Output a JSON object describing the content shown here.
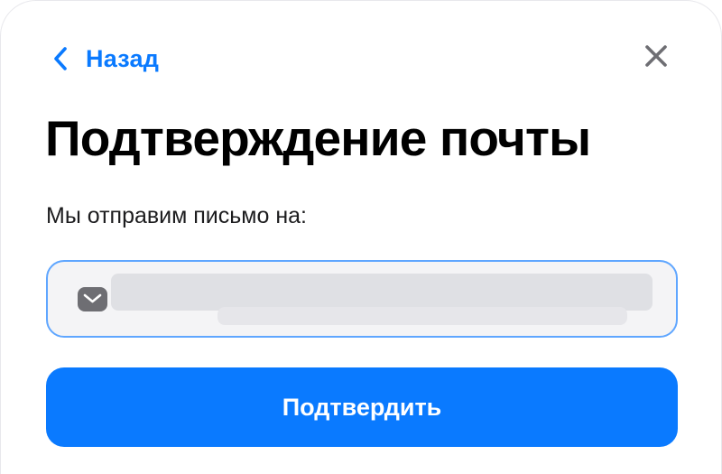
{
  "header": {
    "back_label": "Назад",
    "back_icon": "chevron-left-icon",
    "close_icon": "close-icon"
  },
  "title": "Подтверждение почты",
  "subtitle": "Мы отправим письмо на:",
  "email_field": {
    "icon": "mail-icon",
    "value": "",
    "redacted": true
  },
  "confirm_button": {
    "label": "Подтвердить"
  },
  "colors": {
    "accent": "#0a7aff",
    "field_border": "#5fa6ff",
    "field_background": "#f4f4f6",
    "icon_gray": "#6e6e73"
  }
}
